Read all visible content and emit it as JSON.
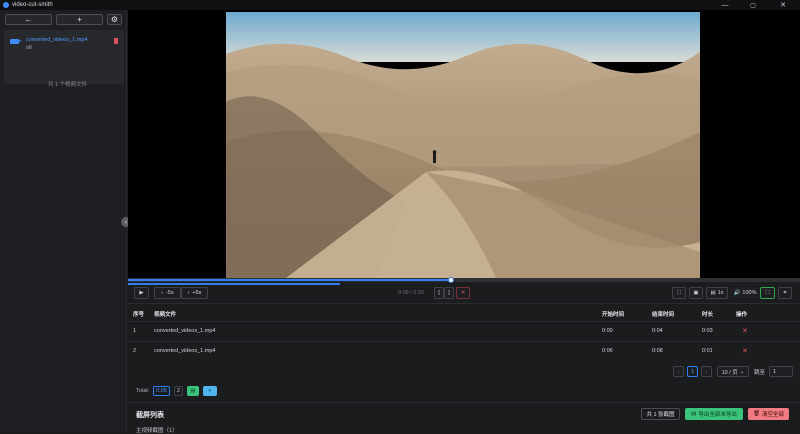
{
  "window": {
    "title": "video-cut-smith",
    "min": "—",
    "max": "▢",
    "close": "✕"
  },
  "sidebar": {
    "back_icon": "arrow-left",
    "add_icon": "plus",
    "settings_icon": "gear",
    "file": {
      "name": "converted_videos_1.mp4",
      "sub": "s6"
    },
    "count_text": "共 1 个视频文件",
    "collapse_icon": "chevron-left"
  },
  "player": {
    "progress": 0.48,
    "segments": [
      0.63
    ],
    "controls": {
      "play": "▶",
      "back5": "-5s",
      "fwd5": "+5s",
      "timecode": "0:09 / 0:20",
      "mark_in": "{",
      "mark_out": "}",
      "clear": "✕",
      "speed": "1x",
      "volume": "100%"
    }
  },
  "table": {
    "headers": [
      "序号",
      "视频文件",
      "开始时间",
      "结束时间",
      "时长",
      "操作"
    ],
    "rows": [
      {
        "index": "1",
        "file": "converted_videos_1.mp4",
        "start": "0:00",
        "end": "0:04",
        "duration": "0:03",
        "action": "✕"
      },
      {
        "index": "2",
        "file": "converted_videos_1.mp4",
        "start": "0:06",
        "end": "0:08",
        "duration": "0:01",
        "action": "✕"
      }
    ]
  },
  "pagination": {
    "prev": "‹",
    "current": "1",
    "next": "›",
    "page_size": "10 / 页",
    "goto_label": "跳至",
    "goto_value": "1"
  },
  "total": {
    "label": "Total:",
    "value": "0:05",
    "count": "2"
  },
  "screenshots": {
    "title": "截屏列表",
    "subtitle": "主视频截图（1）",
    "count_button": "共 1 张截图",
    "export_button": "导出全部未导出",
    "clear_button": "清空全部"
  },
  "colors": {
    "accent": "#2f7ff0",
    "danger": "#e05260",
    "success": "#3ac37a",
    "info": "#4fb5ee"
  }
}
